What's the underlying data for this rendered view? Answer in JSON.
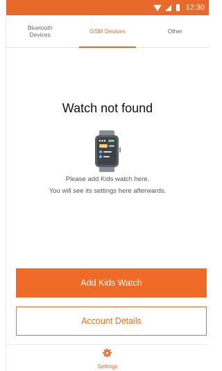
{
  "status_bar": {
    "time": "12:30"
  },
  "tabs": [
    {
      "label": "Bluetooth\nDevices",
      "active": false
    },
    {
      "label": "GSM Devices",
      "active": true
    },
    {
      "label": "Other",
      "active": false
    }
  ],
  "empty_state": {
    "title": "Watch not found",
    "message_line1": "Please add Kids watch here.",
    "message_line2": "You will see its settings here afterwards."
  },
  "buttons": {
    "add_kids_watch": "Add Kids Watch",
    "account_details": "Account Details"
  },
  "bottom_nav": {
    "settings_label": "Settings"
  },
  "colors": {
    "accent": "#e9692c",
    "button_primary": "#ee6a26"
  },
  "icons": {
    "watch": "smartwatch-icon",
    "settings": "gear-icon",
    "wifi": "wifi-icon",
    "signal": "signal-icon",
    "battery": "battery-icon"
  }
}
